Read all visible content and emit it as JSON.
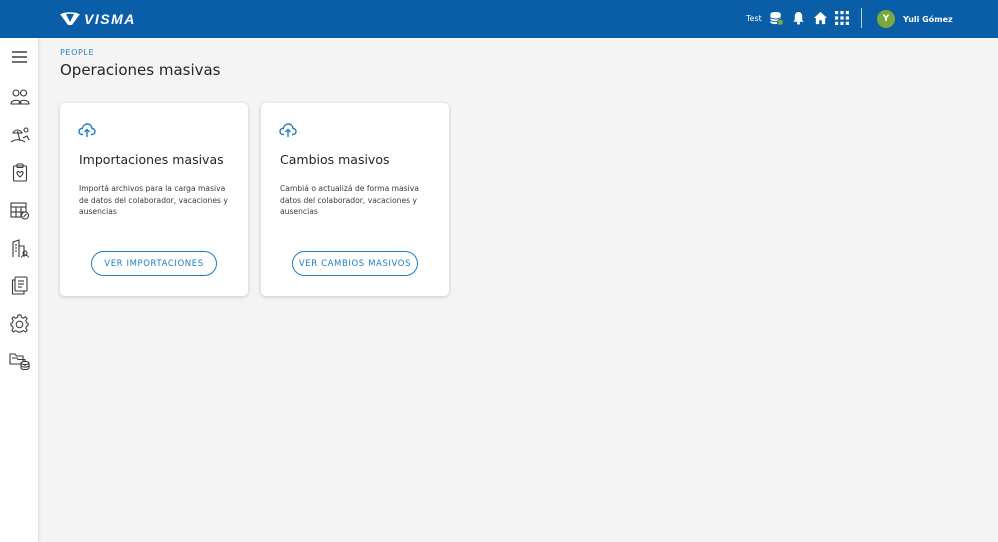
{
  "header": {
    "logo_text": "VISMA",
    "env_label": "Test",
    "icons": [
      "database-status-icon",
      "bell-icon",
      "home-icon",
      "apps-grid-icon"
    ],
    "user": {
      "initial": "Y",
      "name": "Yuli Gómez"
    },
    "colors": {
      "bar": "#0a5ea8",
      "avatar": "#7aa83b"
    }
  },
  "sidebar": {
    "items": [
      {
        "icon": "hamburger-menu-icon"
      },
      {
        "icon": "people-icon"
      },
      {
        "icon": "vacation-beach-icon"
      },
      {
        "icon": "clipboard-health-icon"
      },
      {
        "icon": "calendar-edit-icon"
      },
      {
        "icon": "company-building-icon"
      },
      {
        "icon": "documents-icon"
      },
      {
        "icon": "settings-gear-icon"
      },
      {
        "icon": "folders-database-icon"
      }
    ]
  },
  "page": {
    "breadcrumb": "PEOPLE",
    "title": "Operaciones masivas"
  },
  "cards": [
    {
      "icon": "upload-cloud-icon",
      "title": "Importaciones masivas",
      "description": "Importá archivos para la carga masiva de datos del colaborador, vacaciones y ausencias",
      "button": "VER IMPORTACIONES"
    },
    {
      "icon": "upload-cloud-icon",
      "title": "Cambios masivos",
      "description": "Cambiá o actualizá de forma masiva datos del colaborador, vacaciones y ausencias",
      "button": "VER CAMBIOS MASIVOS"
    }
  ],
  "accent_color": "#1c7ec6"
}
